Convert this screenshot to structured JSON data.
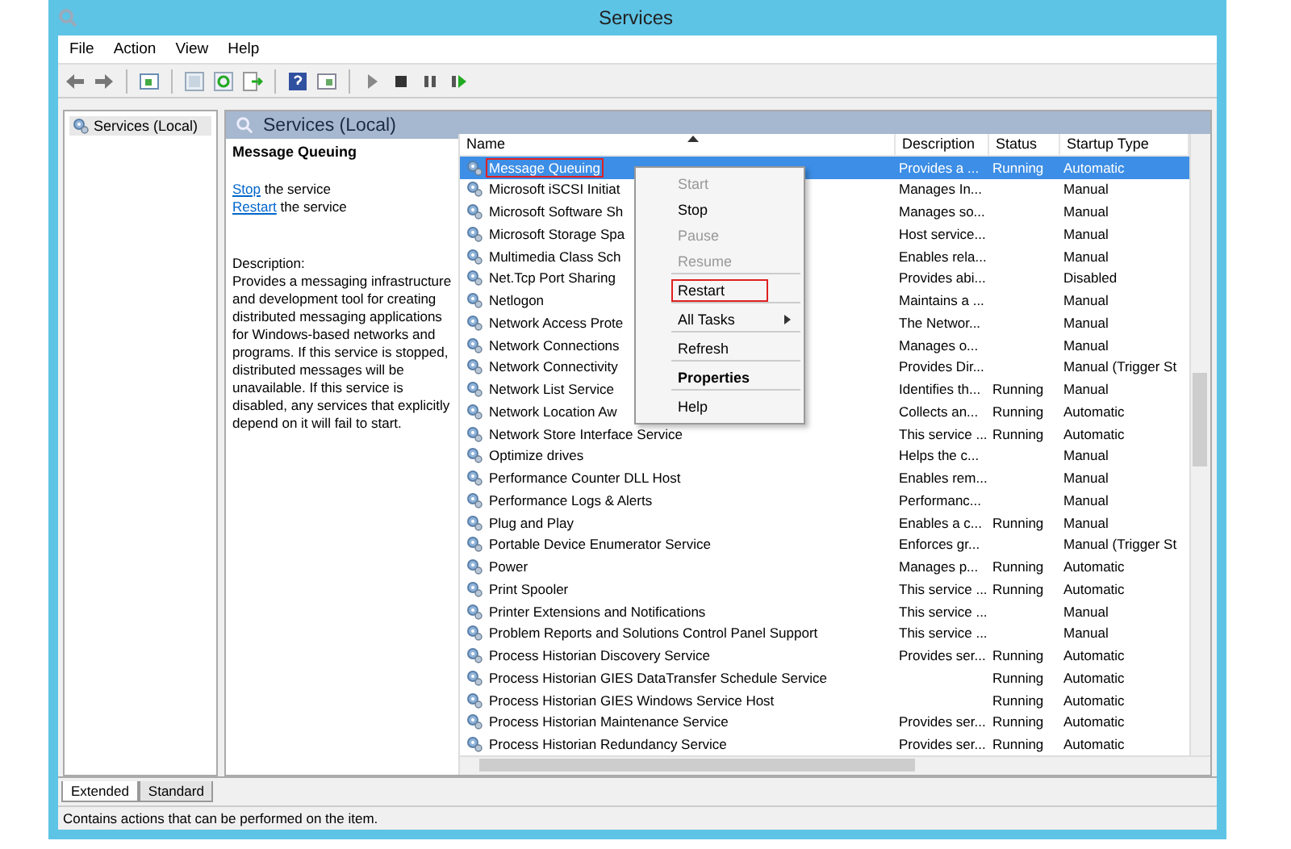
{
  "window": {
    "title": "Services"
  },
  "menu": [
    "File",
    "Action",
    "View",
    "Help"
  ],
  "tree": [
    {
      "label": "Services (Local)",
      "selected": true
    }
  ],
  "panel_title": "Services (Local)",
  "details": {
    "title": "Message Queuing",
    "actions": [
      {
        "link": "Stop",
        "text": "the service"
      },
      {
        "link": "Restart",
        "text": "the service"
      }
    ],
    "description_label": "Description:",
    "description": "Provides a messaging infrastructure and development tool for creating distributed messaging applications for Windows-based networks and programs. If this service is stopped, distributed messages will be unavailable. If this service is disabled, any services that explicitly depend on it will fail to start."
  },
  "table": {
    "columns": [
      "Name",
      "Description",
      "Status",
      "Startup Type"
    ],
    "rows": [
      {
        "name": "Message Queuing",
        "description": "Provides a ...",
        "status": "Running",
        "startup": "Automatic",
        "selected": true,
        "highlighted": true
      },
      {
        "name": "Microsoft iSCSI Initiat",
        "description": "Manages In...",
        "status": "",
        "startup": "Manual",
        "selected": false,
        "highlighted": false
      },
      {
        "name": "Microsoft Software Sh",
        "description": "Manages so...",
        "status": "",
        "startup": "Manual",
        "selected": false,
        "highlighted": false
      },
      {
        "name": "Microsoft Storage Spa",
        "description": "Host service...",
        "status": "",
        "startup": "Manual",
        "selected": false,
        "highlighted": false
      },
      {
        "name": "Multimedia Class Sch",
        "description": "Enables rela...",
        "status": "",
        "startup": "Manual",
        "selected": false,
        "highlighted": false
      },
      {
        "name": "Net.Tcp Port Sharing",
        "description": "Provides abi...",
        "status": "",
        "startup": "Disabled",
        "selected": false,
        "highlighted": false
      },
      {
        "name": "Netlogon",
        "description": "Maintains a ...",
        "status": "",
        "startup": "Manual",
        "selected": false,
        "highlighted": false
      },
      {
        "name": "Network Access Prote",
        "description": "The Networ...",
        "status": "",
        "startup": "Manual",
        "selected": false,
        "highlighted": false
      },
      {
        "name": "Network Connections",
        "description": "Manages o...",
        "status": "",
        "startup": "Manual",
        "selected": false,
        "highlighted": false
      },
      {
        "name": "Network Connectivity",
        "description": "Provides Dir...",
        "status": "",
        "startup": "Manual (Trigger St",
        "selected": false,
        "highlighted": false
      },
      {
        "name": "Network List Service",
        "description": "Identifies th...",
        "status": "Running",
        "startup": "Manual",
        "selected": false,
        "highlighted": false
      },
      {
        "name": "Network Location Aw",
        "description": "Collects an...",
        "status": "Running",
        "startup": "Automatic",
        "selected": false,
        "highlighted": false
      },
      {
        "name": "Network Store Interface Service",
        "description": "This service ...",
        "status": "Running",
        "startup": "Automatic",
        "selected": false,
        "highlighted": false
      },
      {
        "name": "Optimize drives",
        "description": "Helps the c...",
        "status": "",
        "startup": "Manual",
        "selected": false,
        "highlighted": false
      },
      {
        "name": "Performance Counter DLL Host",
        "description": "Enables rem...",
        "status": "",
        "startup": "Manual",
        "selected": false,
        "highlighted": false
      },
      {
        "name": "Performance Logs & Alerts",
        "description": "Performanc...",
        "status": "",
        "startup": "Manual",
        "selected": false,
        "highlighted": false
      },
      {
        "name": "Plug and Play",
        "description": "Enables a c...",
        "status": "Running",
        "startup": "Manual",
        "selected": false,
        "highlighted": false
      },
      {
        "name": "Portable Device Enumerator Service",
        "description": "Enforces gr...",
        "status": "",
        "startup": "Manual (Trigger St",
        "selected": false,
        "highlighted": false
      },
      {
        "name": "Power",
        "description": "Manages p...",
        "status": "Running",
        "startup": "Automatic",
        "selected": false,
        "highlighted": false
      },
      {
        "name": "Print Spooler",
        "description": "This service ...",
        "status": "Running",
        "startup": "Automatic",
        "selected": false,
        "highlighted": false
      },
      {
        "name": "Printer Extensions and Notifications",
        "description": "This service ...",
        "status": "",
        "startup": "Manual",
        "selected": false,
        "highlighted": false
      },
      {
        "name": "Problem Reports and Solutions Control Panel Support",
        "description": "This service ...",
        "status": "",
        "startup": "Manual",
        "selected": false,
        "highlighted": false
      },
      {
        "name": "Process Historian Discovery Service",
        "description": "Provides ser...",
        "status": "Running",
        "startup": "Automatic",
        "selected": false,
        "highlighted": false
      },
      {
        "name": "Process Historian GIES DataTransfer Schedule Service",
        "description": "",
        "status": "Running",
        "startup": "Automatic",
        "selected": false,
        "highlighted": false
      },
      {
        "name": "Process Historian GIES Windows Service Host",
        "description": "",
        "status": "Running",
        "startup": "Automatic",
        "selected": false,
        "highlighted": false
      },
      {
        "name": "Process Historian Maintenance Service",
        "description": "Provides ser...",
        "status": "Running",
        "startup": "Automatic",
        "selected": false,
        "highlighted": false
      },
      {
        "name": "Process Historian Redundancy Service",
        "description": "Provides ser...",
        "status": "Running",
        "startup": "Automatic",
        "selected": false,
        "highlighted": false
      }
    ]
  },
  "context_menu": [
    {
      "label": "Start",
      "disabled": true,
      "divider_after": false,
      "submenu": false,
      "bold": false,
      "highlighted": false
    },
    {
      "label": "Stop",
      "disabled": false,
      "divider_after": false,
      "submenu": false,
      "bold": false,
      "highlighted": false
    },
    {
      "label": "Pause",
      "disabled": true,
      "divider_after": false,
      "submenu": false,
      "bold": false,
      "highlighted": false
    },
    {
      "label": "Resume",
      "disabled": true,
      "divider_after": true,
      "submenu": false,
      "bold": false,
      "highlighted": false
    },
    {
      "label": "Restart",
      "disabled": false,
      "divider_after": true,
      "submenu": false,
      "bold": false,
      "highlighted": true
    },
    {
      "label": "All Tasks",
      "disabled": false,
      "divider_after": true,
      "submenu": true,
      "bold": false,
      "highlighted": false
    },
    {
      "label": "Refresh",
      "disabled": false,
      "divider_after": true,
      "submenu": false,
      "bold": false,
      "highlighted": false
    },
    {
      "label": "Properties",
      "disabled": false,
      "divider_after": true,
      "submenu": false,
      "bold": true,
      "highlighted": false
    },
    {
      "label": "Help",
      "disabled": false,
      "divider_after": false,
      "submenu": false,
      "bold": false,
      "highlighted": false
    }
  ],
  "view_tabs": [
    {
      "label": "Extended",
      "selected": true
    },
    {
      "label": "Standard",
      "selected": false
    }
  ],
  "status_bar": "Contains actions that can be performed on the item."
}
